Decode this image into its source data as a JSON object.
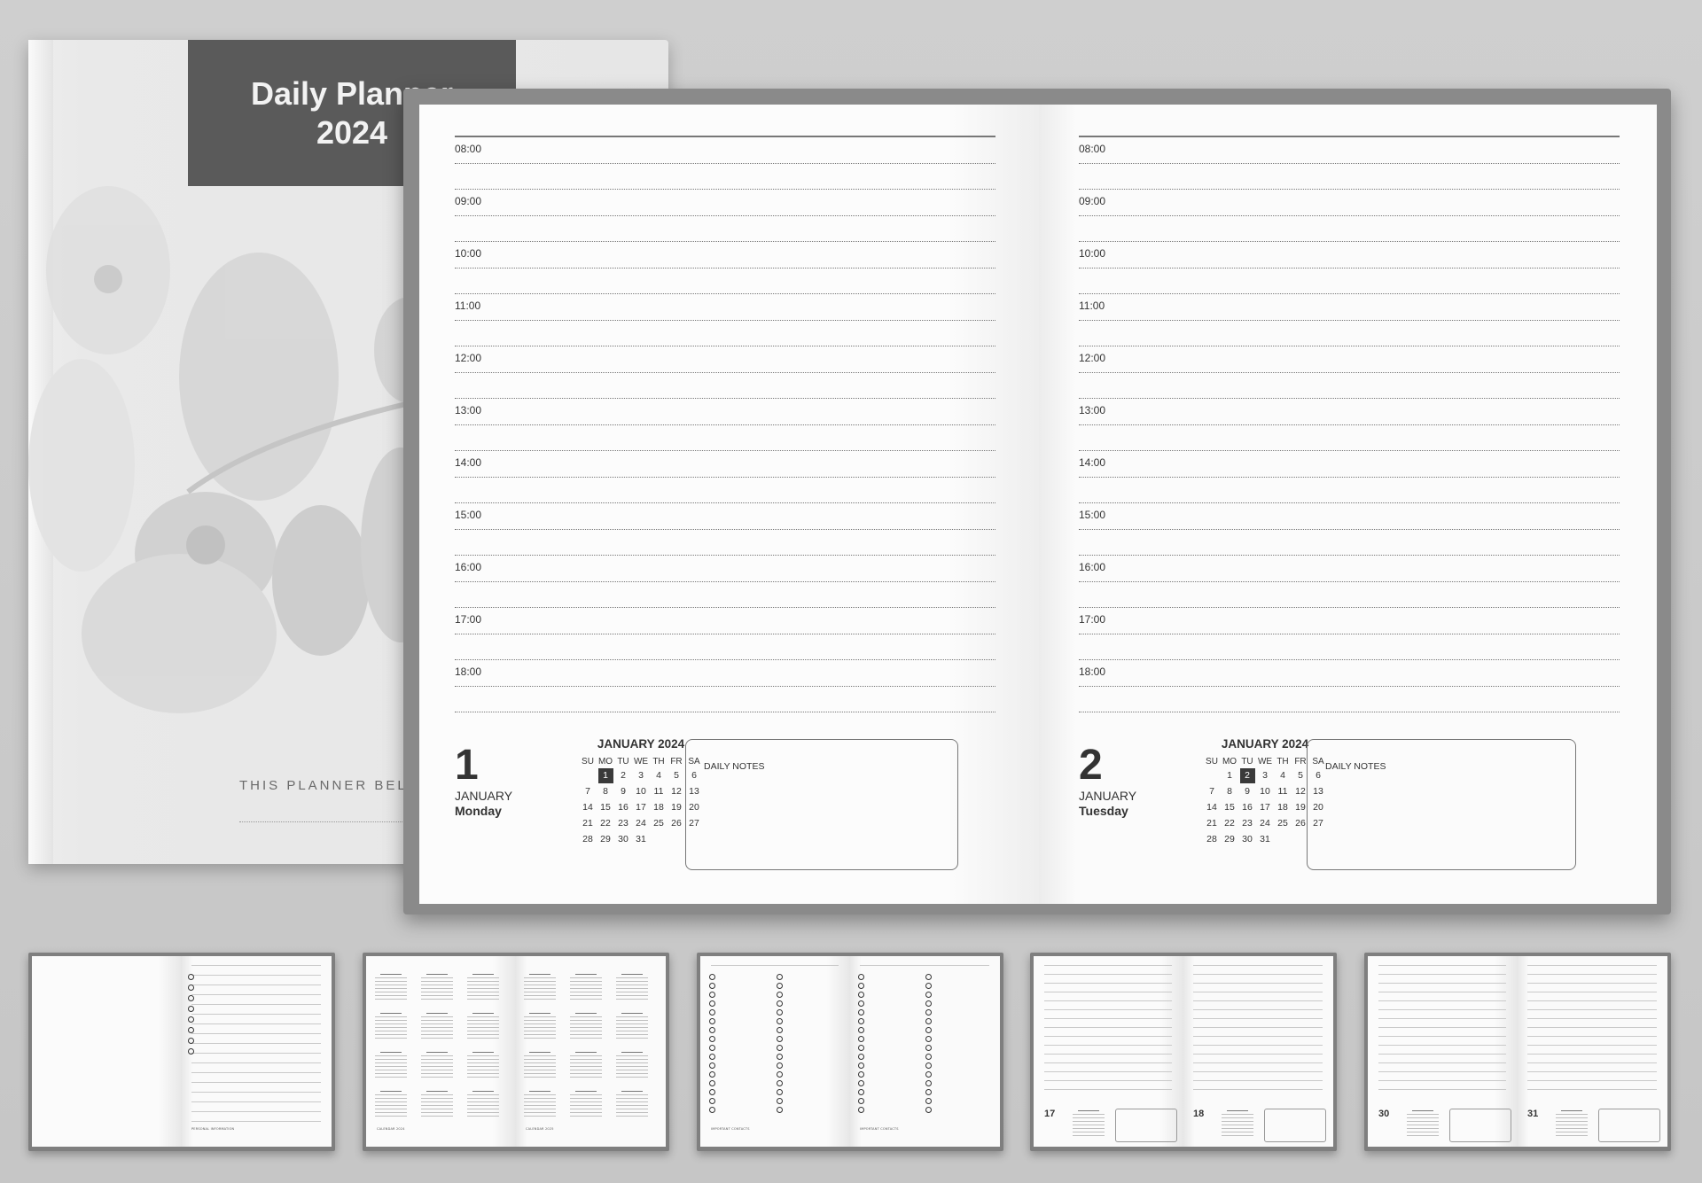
{
  "cover": {
    "title_line1": "Daily Planner",
    "title_line2": "2024",
    "belongs_text": "THIS PLANNER BELONGS TO"
  },
  "hours": [
    "08:00",
    "09:00",
    "10:00",
    "11:00",
    "12:00",
    "13:00",
    "14:00",
    "15:00",
    "16:00",
    "17:00",
    "18:00"
  ],
  "weekday_headers": [
    "SU",
    "MO",
    "TU",
    "WE",
    "TH",
    "FR",
    "SA"
  ],
  "calendar": {
    "title": "JANUARY 2024",
    "weeks": [
      [
        "",
        "1",
        "2",
        "3",
        "4",
        "5",
        "6"
      ],
      [
        "7",
        "8",
        "9",
        "10",
        "11",
        "12",
        "13"
      ],
      [
        "14",
        "15",
        "16",
        "17",
        "18",
        "19",
        "20"
      ],
      [
        "21",
        "22",
        "23",
        "24",
        "25",
        "26",
        "27"
      ],
      [
        "28",
        "29",
        "30",
        "31",
        "",
        "",
        ""
      ]
    ]
  },
  "left_page": {
    "day_number": "1",
    "month": "JANUARY",
    "weekday": "Monday",
    "selected_date": "1",
    "notes_label": "DAILY NOTES"
  },
  "right_page": {
    "day_number": "2",
    "month": "JANUARY",
    "weekday": "Tuesday",
    "selected_date": "2",
    "notes_label": "DAILY NOTES"
  },
  "thumbnails": {
    "t1_footer": "PERSONAL INFORMATION",
    "t2_footer_left": "CALENDAR 2024",
    "t2_footer_right": "CALENDAR 2025",
    "t3_footer_left": "IMPORTANT CONTACTS",
    "t3_footer_right": "IMPORTANT CONTACTS",
    "t4_left_num": "17",
    "t4_right_num": "18",
    "t5_left_num": "30",
    "t5_right_num": "31"
  }
}
